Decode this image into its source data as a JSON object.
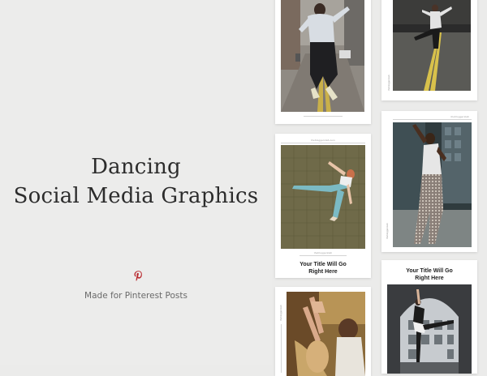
{
  "hero": {
    "title_line1": "Dancing",
    "title_line2": "Social Media Graphics",
    "subtitle": "Made for Pinterest Posts",
    "pinterest_color": "#b8272c"
  },
  "cards": {
    "c1": {
      "url": "",
      "side": ""
    },
    "c2": {
      "url": "",
      "side": "thebloggerslab"
    },
    "c3": {
      "url": "thebloggerslab.com",
      "footer_url": "thebloggerslab",
      "caption1": "Your Title Will Go",
      "caption2": "Right Here"
    },
    "c4": {
      "url": "thebloggerslab",
      "side": "thebloggerslab"
    },
    "c5": {
      "caption1": "Your Title Will Go",
      "caption2": "Right Here"
    },
    "c6": {
      "side": "thebloggerslab"
    }
  }
}
